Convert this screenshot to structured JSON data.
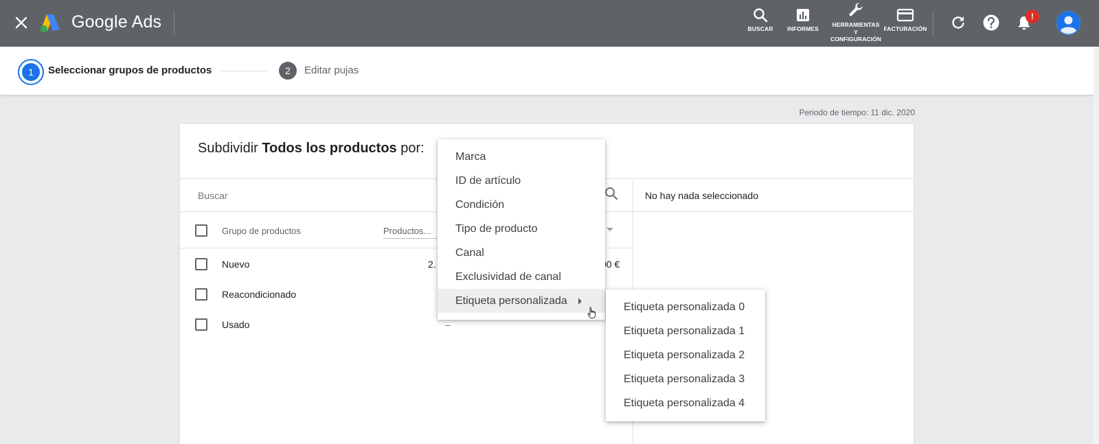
{
  "header": {
    "brand": "Google Ads",
    "nav": [
      {
        "label": "BUSCAR",
        "icon": "search-icon"
      },
      {
        "label": "INFORMES",
        "icon": "reports-icon"
      },
      {
        "label": "HERRAMIENTAS\nY\nCONFIGURACIÓN",
        "icon": "wrench-icon"
      },
      {
        "label": "FACTURACIÓN",
        "icon": "credit-card-icon"
      }
    ],
    "notification_badge": "!",
    "colors": {
      "bar": "#5f6368",
      "badge": "#d93025"
    }
  },
  "stepper": {
    "steps": [
      {
        "number": "1",
        "label": "Seleccionar grupos de productos",
        "state": "active"
      },
      {
        "number": "2",
        "label": "Editar pujas",
        "state": "inactive"
      }
    ],
    "accent": "#1a73e8"
  },
  "period": "Periodo de tiempo: 11 dic. 2020",
  "card": {
    "title_prefix": "Subdividir ",
    "title_bold": "Todos los productos",
    "title_suffix": " por:",
    "search_placeholder": "Buscar",
    "right_panel_text": "No hay nada seleccionado",
    "columns": [
      "Grupo de productos",
      "Productos..."
    ],
    "rows": [
      {
        "name": "Nuevo",
        "products": "2.",
        "value": "00 €"
      },
      {
        "name": "Reacondicionado",
        "products": "",
        "value": ""
      },
      {
        "name": "Usado",
        "products": "–",
        "value": ""
      }
    ]
  },
  "menu": {
    "items": [
      "Marca",
      "ID de artículo",
      "Condición",
      "Tipo de producto",
      "Canal",
      "Exclusividad de canal",
      "Etiqueta personalizada"
    ],
    "active_index": 6
  },
  "submenu": {
    "items": [
      "Etiqueta personalizada 0",
      "Etiqueta personalizada 1",
      "Etiqueta personalizada 2",
      "Etiqueta personalizada 3",
      "Etiqueta personalizada 4"
    ]
  }
}
